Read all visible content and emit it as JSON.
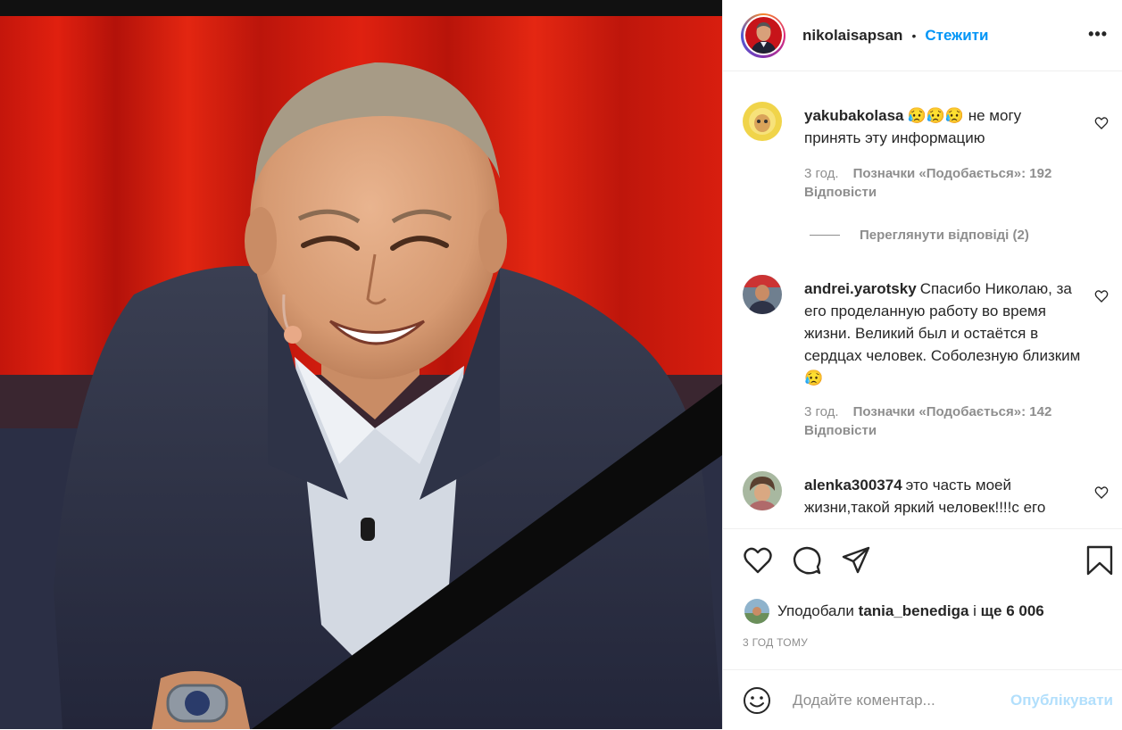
{
  "header": {
    "username": "nikolaisapsan",
    "separator": "•",
    "follow_label": "Стежити",
    "more_label": "•••"
  },
  "comments": [
    {
      "username": "yakubakolasa",
      "text": "😥😥😥 не могу принять эту информацию",
      "time": "3 год.",
      "likes": "Позначки «Подобається»: 192",
      "reply": "Відповісти",
      "avatar_icon": "avatar-yellow"
    },
    {
      "username": "andrei.yarotsky",
      "text": "Спасибо Николаю, за его проделанную работу во время жизни. Великий был и остаётся в сердцах человек. Соболезную близким😥",
      "time": "3 год.",
      "likes": "Позначки «Подобається»: 142",
      "reply": "Відповісти",
      "avatar_icon": "avatar-man"
    },
    {
      "username": "alenka300374",
      "text": "это часть моей жизни,такой яркий человек!!!!с его",
      "avatar_icon": "avatar-woman"
    }
  ],
  "view_replies": "Переглянути відповіді (2)",
  "actions": {
    "like_icon": "heart-icon",
    "comment_icon": "comment-icon",
    "share_icon": "share-icon",
    "save_icon": "bookmark-icon"
  },
  "liked_by": {
    "prefix": "Уподобали",
    "user": "tania_benediga",
    "conj": "і",
    "rest": "ще 6 006"
  },
  "post_time": "3 ГОД ТОМУ",
  "add_comment": {
    "placeholder": "Додайте коментар...",
    "publish_label": "Опублікувати"
  },
  "colors": {
    "accent": "#0095f6",
    "publish_disabled": "#b2dffc",
    "muted": "#8e8e8e",
    "text": "#262626"
  }
}
